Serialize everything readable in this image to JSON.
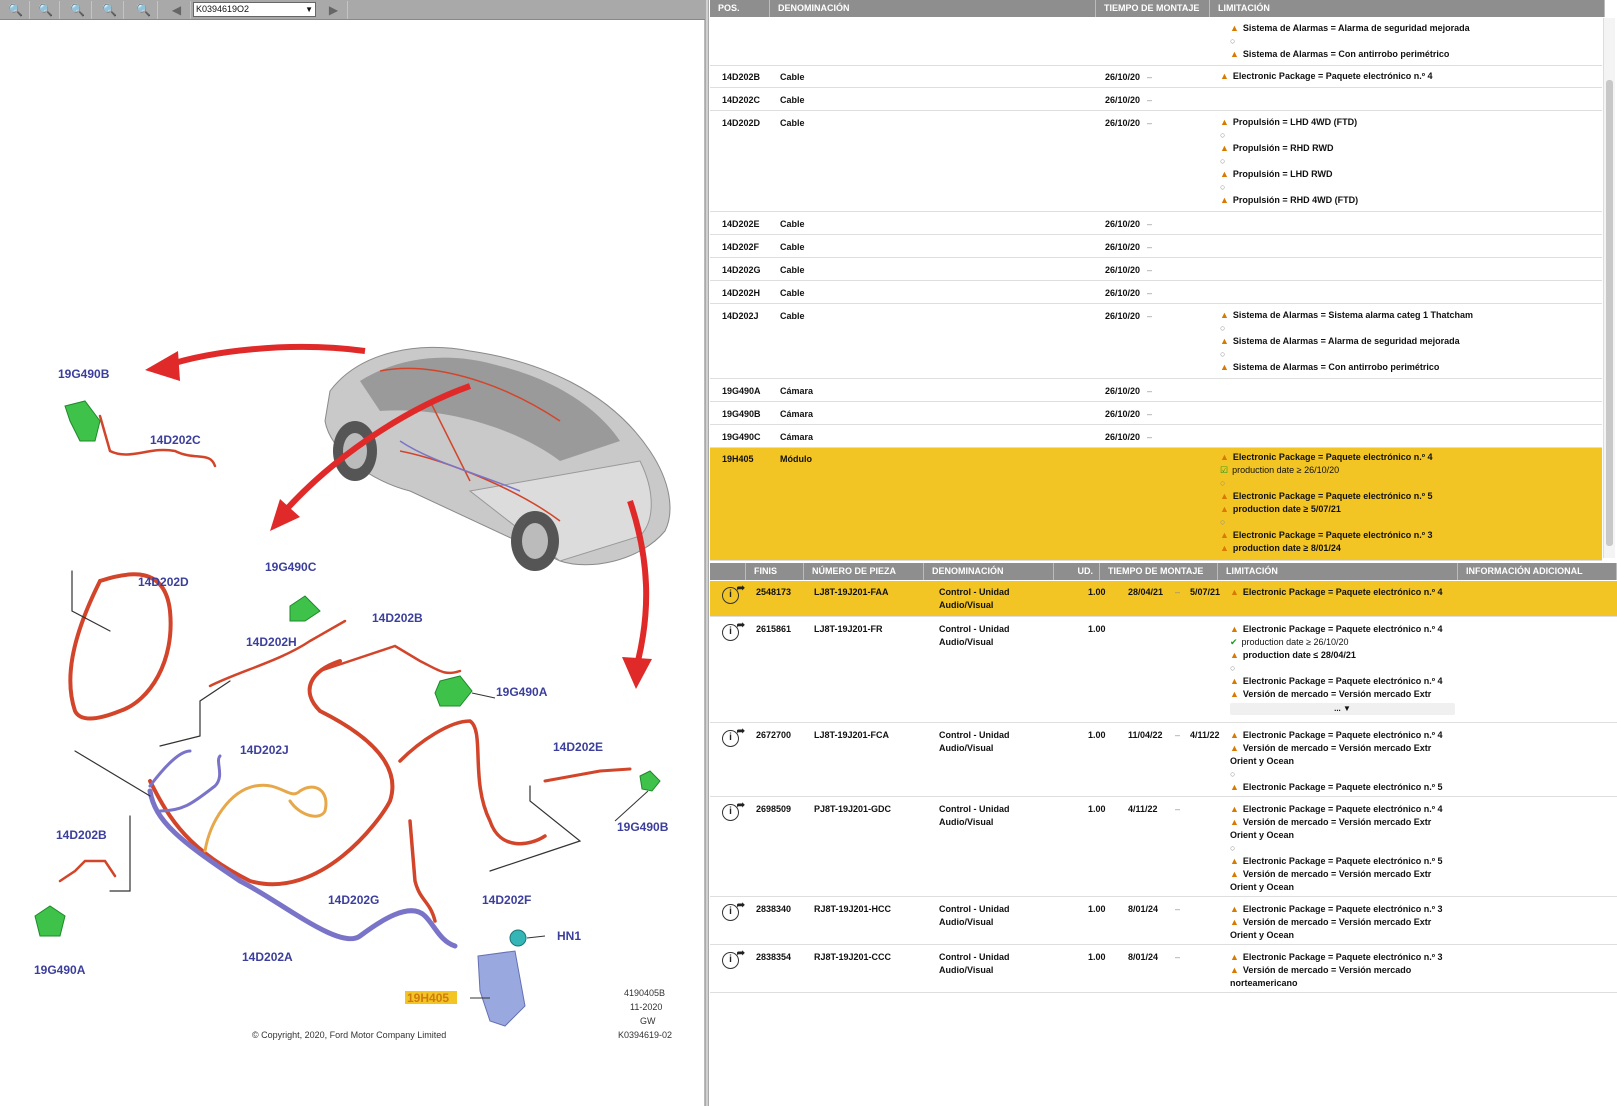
{
  "toolbar": {
    "doc_id": "K0394619O2"
  },
  "diagram": {
    "labels": {
      "l1": "19G490B",
      "l2": "14D202C",
      "l3": "19G490C",
      "l4": "14D202D",
      "l5": "14D202B",
      "l6": "14D202H",
      "l7": "19G490A",
      "l8": "14D202J",
      "l9": "14D202E",
      "l10": "19G490B",
      "l11": "14D202B",
      "l12": "14D202G",
      "l13": "14D202F",
      "l14": "HN1",
      "l15": "14D202A",
      "l16": "19G490A",
      "l17": "19H405"
    },
    "ref1": "4190405B",
    "ref2": "11-2020",
    "ref3": "GW",
    "ref4": "K0394619-02",
    "copyright": "© Copyright, 2020, Ford Motor Company Limited"
  },
  "upper": {
    "headers": {
      "pos": "POS.",
      "den": "DENOMINACIÓN",
      "tiempo": "TIEMPO DE MONTAJE",
      "lim": "LIMITACIÓN"
    },
    "top_lims": [
      "Sistema de Alarmas = Alarma de seguridad mejorada",
      "Sistema de Alarmas = Con antirrobo perimétrico"
    ],
    "rows": [
      {
        "pos": "14D202B",
        "den": "Cable",
        "t": "26/10/20",
        "lims": [
          "Electronic Package = Paquete electrónico n.º 4"
        ]
      },
      {
        "pos": "14D202C",
        "den": "Cable",
        "t": "26/10/20",
        "lims": []
      },
      {
        "pos": "14D202D",
        "den": "Cable",
        "t": "26/10/20",
        "lims": [
          "Propulsión = LHD 4WD (FTD)",
          "Propulsión = RHD RWD",
          "Propulsión = LHD RWD",
          "Propulsión = RHD 4WD (FTD)"
        ]
      },
      {
        "pos": "14D202E",
        "den": "Cable",
        "t": "26/10/20",
        "lims": []
      },
      {
        "pos": "14D202F",
        "den": "Cable",
        "t": "26/10/20",
        "lims": []
      },
      {
        "pos": "14D202G",
        "den": "Cable",
        "t": "26/10/20",
        "lims": []
      },
      {
        "pos": "14D202H",
        "den": "Cable",
        "t": "26/10/20",
        "lims": []
      },
      {
        "pos": "14D202J",
        "den": "Cable",
        "t": "26/10/20",
        "lims": [
          "Sistema de Alarmas = Sistema alarma categ 1 Thatcham",
          "Sistema de Alarmas = Alarma de seguridad mejorada",
          "Sistema de Alarmas = Con antirrobo perimétrico"
        ]
      },
      {
        "pos": "19G490A",
        "den": "Cámara",
        "t": "26/10/20",
        "lims": []
      },
      {
        "pos": "19G490B",
        "den": "Cámara",
        "t": "26/10/20",
        "lims": []
      },
      {
        "pos": "19G490C",
        "den": "Cámara",
        "t": "26/10/20",
        "lims": []
      }
    ],
    "module": {
      "pos": "19H405",
      "den": "Módulo",
      "l1": "Electronic Package = Paquete electrónico n.º 4",
      "l2": "production date ≥ 26/10/20",
      "l3": "Electronic Package = Paquete electrónico n.º 5",
      "l4": "production date ≥ 5/07/21",
      "l5": "Electronic Package = Paquete electrónico n.º 3",
      "l6": "production date ≥ 8/01/24"
    }
  },
  "lower": {
    "headers": {
      "finis": "FINIS",
      "num": "NÚMERO DE PIEZA",
      "den": "DENOMINACIÓN",
      "ud": "UD.",
      "tiempo": "TIEMPO DE MONTAJE",
      "lim": "LIMITACIÓN",
      "info": "INFORMACIÓN ADICIONAL"
    },
    "rows": [
      {
        "finis": "2548173",
        "num": "LJ8T-19J201-FAA",
        "den1": "Control - Unidad",
        "den2": "Audio/Visual",
        "ud": "1.00",
        "from": "28/04/21",
        "to": "5/07/21",
        "lims": [
          "Electronic Package = Paquete electrónico n.º 4"
        ]
      },
      {
        "finis": "2615861",
        "num": "LJ8T-19J201-FR",
        "den1": "Control - Unidad",
        "den2": "Audio/Visual",
        "ud": "1.00",
        "from": "",
        "to": "",
        "lims": [
          "Electronic Package = Paquete electrónico n.º 4",
          "production date ≥ 26/10/20",
          "production date ≤ 28/04/21",
          "Electronic Package = Paquete electrónico n.º 4",
          "Versión de mercado = Versión mercado Extr"
        ],
        "more": "... ▼"
      },
      {
        "finis": "2672700",
        "num": "LJ8T-19J201-FCA",
        "den1": "Control - Unidad",
        "den2": "Audio/Visual",
        "ud": "1.00",
        "from": "11/04/22",
        "to": "4/11/22",
        "lims": [
          "Electronic Package = Paquete electrónico n.º 4",
          "Versión de mercado = Versión mercado Extr",
          "Orient y Ocean",
          "Electronic Package = Paquete electrónico n.º 5"
        ]
      },
      {
        "finis": "2698509",
        "num": "PJ8T-19J201-GDC",
        "den1": "Control - Unidad",
        "den2": "Audio/Visual",
        "ud": "1.00",
        "from": "4/11/22",
        "to": "",
        "lims": [
          "Electronic Package = Paquete electrónico n.º 4",
          "Versión de mercado = Versión mercado Extr",
          "Orient y Ocean",
          "Electronic Package = Paquete electrónico n.º 5",
          "Versión de mercado = Versión mercado Extr",
          "Orient y Ocean"
        ]
      },
      {
        "finis": "2838340",
        "num": "RJ8T-19J201-HCC",
        "den1": "Control - Unidad",
        "den2": "Audio/Visual",
        "ud": "1.00",
        "from": "8/01/24",
        "to": "",
        "lims": [
          "Electronic Package = Paquete electrónico n.º 3",
          "Versión de mercado = Versión mercado Extr",
          "Orient y Ocean"
        ]
      },
      {
        "finis": "2838354",
        "num": "RJ8T-19J201-CCC",
        "den1": "Control - Unidad",
        "den2": "Audio/Visual",
        "ud": "1.00",
        "from": "8/01/24",
        "to": "",
        "lims": [
          "Electronic Package = Paquete electrónico n.º 3",
          "Versión de mercado = Versión mercado",
          "norteamericano"
        ]
      }
    ]
  },
  "colors": {
    "highlight": "#f3c524",
    "header": "#8e8e8e",
    "toolbar": "#a9a9a9",
    "wire": "#d2452a",
    "wire_blue": "#7a74c9",
    "component": "#3ec24a",
    "label": "#3b3f9b"
  }
}
